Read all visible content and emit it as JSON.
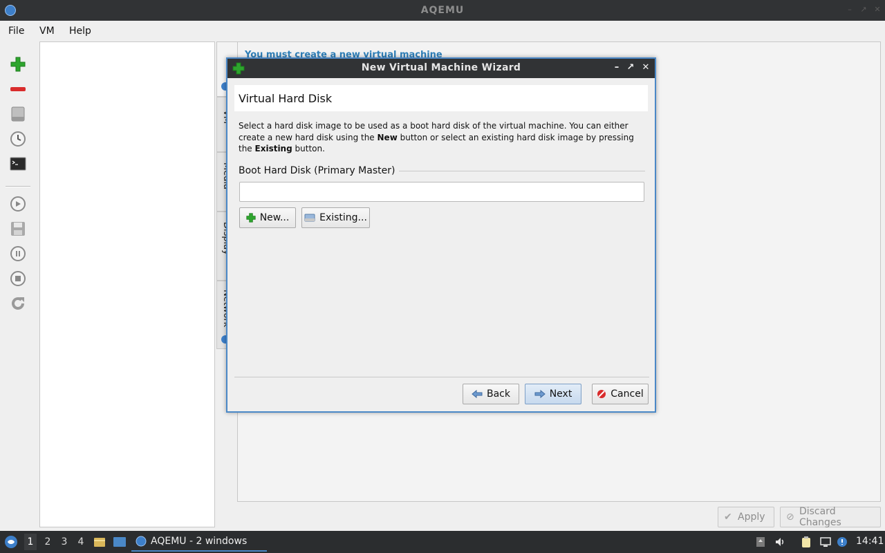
{
  "window": {
    "title": "AQEMU"
  },
  "menu": [
    "File",
    "VM",
    "Help"
  ],
  "toolbar": {
    "buttons": [
      "add-vm-icon",
      "remove-vm-icon",
      "hard-disk-icon",
      "clock-icon",
      "terminal-icon",
      "play-icon",
      "save-icon",
      "pause-icon",
      "stop-icon",
      "reload-icon"
    ]
  },
  "main": {
    "message": "You must create a new virtual machine",
    "tabs": [
      "VM",
      "Media",
      "Display",
      "Network"
    ],
    "apply_label": "Apply",
    "discard_label": "Discard Changes"
  },
  "dialog": {
    "title": "New Virtual Machine Wizard",
    "page_title": "Virtual Hard Disk",
    "description_1": "Select a hard disk image to be used as a boot hard disk of the virtual machine. You can either create a new hard disk using the ",
    "description_new": "New",
    "description_2": " button or select an existing hard disk image by pressing the ",
    "description_existing": "Existing",
    "description_3": " button.",
    "group_title": "Boot Hard Disk (Primary Master)",
    "disk_path": "",
    "new_label": "New...",
    "existing_label": "Existing...",
    "back_label": "Back",
    "next_label": "Next",
    "cancel_label": "Cancel"
  },
  "taskbar": {
    "desktops": [
      "1",
      "2",
      "3",
      "4"
    ],
    "task_label": "AQEMU - 2 windows",
    "clock": "14:41"
  },
  "colors": {
    "accent": "#4a88c7",
    "message": "#2f7fb8",
    "titlebar": "#313335",
    "taskbar": "#2b2d2f"
  }
}
